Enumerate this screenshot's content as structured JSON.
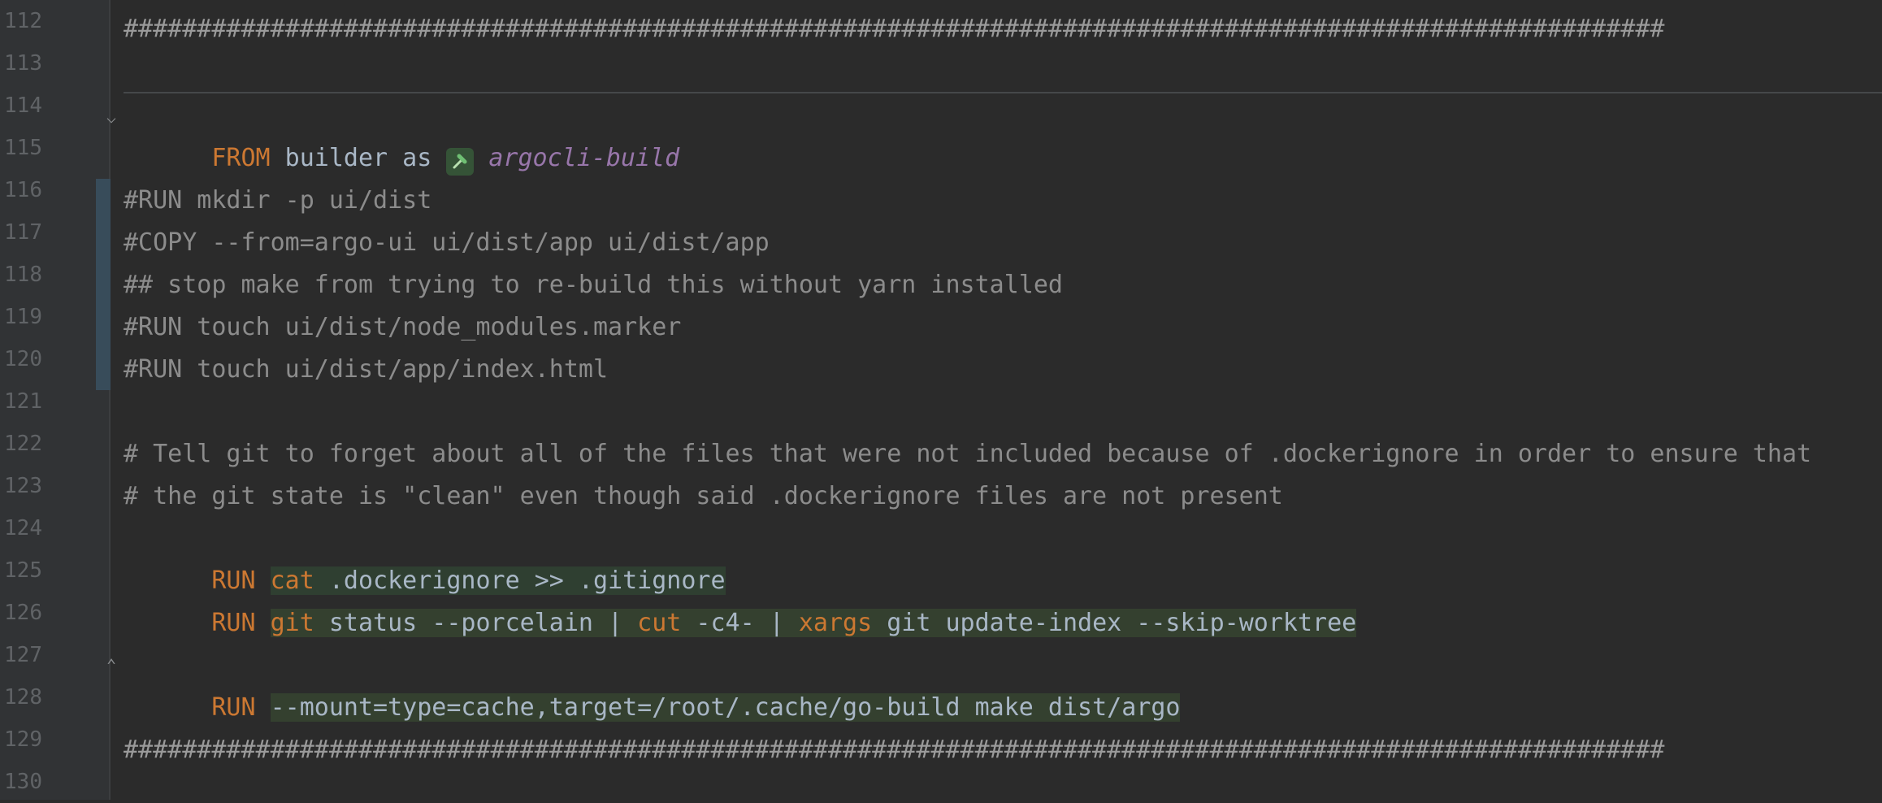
{
  "editor": {
    "line_numbers": [
      "112",
      "113",
      "114",
      "115",
      "116",
      "117",
      "118",
      "119",
      "120",
      "121",
      "122",
      "123",
      "124",
      "125",
      "126",
      "127",
      "128",
      "129",
      "130"
    ],
    "lines": {
      "l112": "#########################################################################################################",
      "l114_kw": "FROM",
      "l114_txt1": " builder as ",
      "l114_stage": "argocli-build",
      "l116": "#RUN mkdir -p ui/dist",
      "l117": "#COPY --from=argo-ui ui/dist/app ui/dist/app",
      "l118": "## stop make from trying to re-build this without yarn installed",
      "l119": "#RUN touch ui/dist/node_modules.marker",
      "l120": "#RUN touch ui/dist/app/index.html",
      "l122": "# Tell git to forget about all of the files that were not included because of .dockerignore in order to ensure that",
      "l123": "# the git state is \"clean\" even though said .dockerignore files are not present",
      "l124_kw": "RUN ",
      "l124_cmd": "cat",
      "l124_rest": " .dockerignore >> .gitignore",
      "l125_kw": "RUN ",
      "l125_cmd1": "git",
      "l125_rest1": " status --porcelain | ",
      "l125_cmd2": "cut",
      "l125_rest2": " -c4- | ",
      "l125_cmd3": "xargs",
      "l125_rest3": " git update-index --skip-worktree",
      "l127_kw": "RUN ",
      "l127_rest": "--mount=type=cache,target=/root/.cache/go-build make dist/argo",
      "l129": "#########################################################################################################"
    }
  },
  "icons": {
    "hammer": "hammer-icon",
    "fold": "fold-icon"
  },
  "colors": {
    "background": "#2b2b2b",
    "keyword": "#cc7832",
    "comment": "#8c8c8c",
    "text": "#a9b7c6",
    "stage": "#9876aa",
    "shell_background": "#34402f"
  }
}
